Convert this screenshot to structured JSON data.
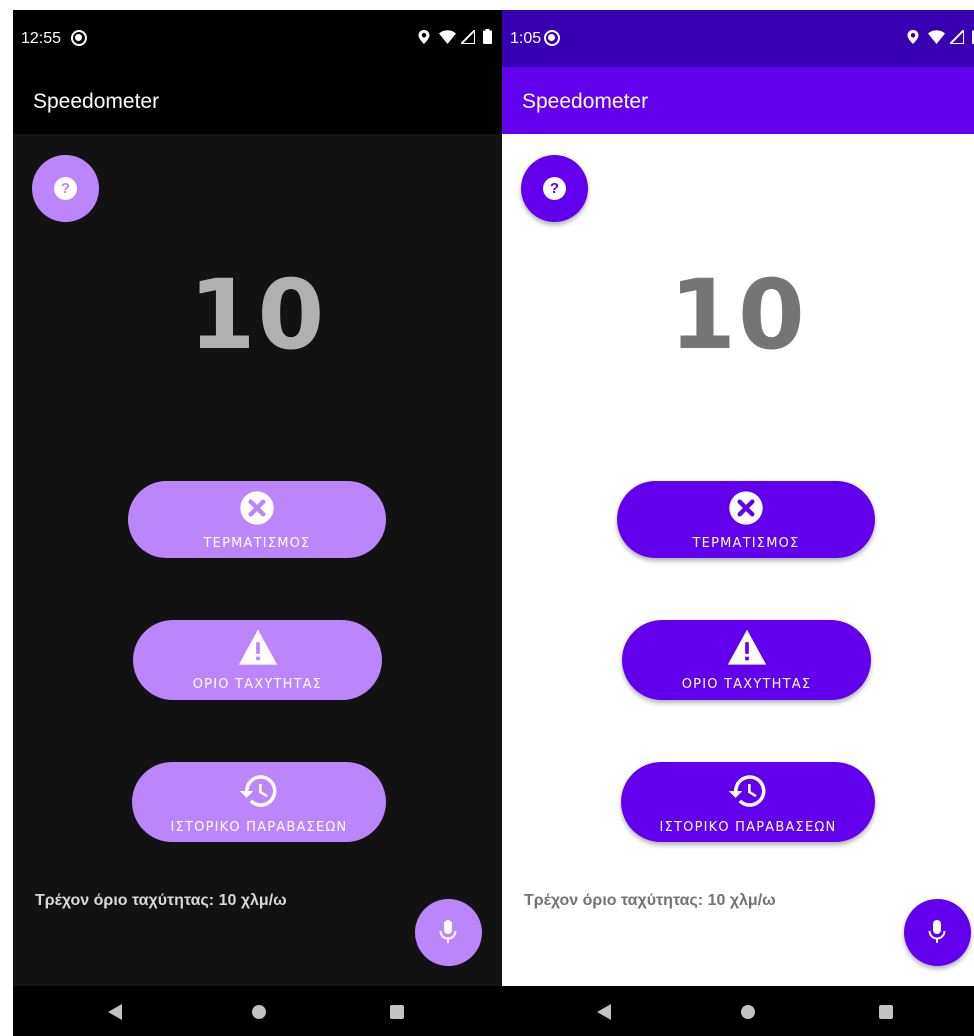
{
  "colors": {
    "dark_primary": "#bb86fc",
    "dark_background": "#121212",
    "dark_bars": "#000000",
    "light_primary": "#6200ee",
    "light_status_bar": "#3700b3",
    "light_background": "#ffffff",
    "nav_bar": "#000000"
  },
  "dark_screen": {
    "status_bar": {
      "time": "12:55",
      "icons": [
        "location-icon",
        "wifi-icon",
        "signal-icon",
        "battery-icon"
      ]
    },
    "app_bar": {
      "title": "Speedometer"
    },
    "help_button": {
      "icon": "help-icon",
      "glyph": "?"
    },
    "speed": "10",
    "buttons": [
      {
        "label": "ΤΕΡΜΑΤΙΣΜΟΣ",
        "icon": "close-circle-icon"
      },
      {
        "label": "ΟΡΙΟ ΤΑΧΥΤΗΤΑΣ",
        "icon": "warning-icon"
      },
      {
        "label": "ΙΣΤΟΡΙΚΟ ΠΑΡΑΒΑΣΕΩΝ",
        "icon": "history-icon"
      }
    ],
    "current_limit_text": "Τρέχον όριο ταχύτητας: 10 χλμ/ω",
    "mic_button": {
      "icon": "microphone-icon"
    },
    "nav_bar": {
      "icons": [
        "back-icon",
        "home-icon",
        "recents-icon"
      ]
    }
  },
  "light_screen": {
    "status_bar": {
      "time": "1:05",
      "icons": [
        "location-icon",
        "wifi-icon",
        "signal-icon",
        "battery-icon"
      ]
    },
    "app_bar": {
      "title": "Speedometer"
    },
    "help_button": {
      "icon": "help-icon",
      "glyph": "?"
    },
    "speed": "10",
    "buttons": [
      {
        "label": "ΤΕΡΜΑΤΙΣΜΟΣ",
        "icon": "close-circle-icon"
      },
      {
        "label": "ΟΡΙΟ ΤΑΧΥΤΗΤΑΣ",
        "icon": "warning-icon"
      },
      {
        "label": "ΙΣΤΟΡΙΚΟ ΠΑΡΑΒΑΣΕΩΝ",
        "icon": "history-icon"
      }
    ],
    "current_limit_text": "Τρέχον όριο ταχύτητας: 10 χλμ/ω",
    "mic_button": {
      "icon": "microphone-icon"
    },
    "nav_bar": {
      "icons": [
        "back-icon",
        "home-icon",
        "recents-icon"
      ]
    }
  }
}
